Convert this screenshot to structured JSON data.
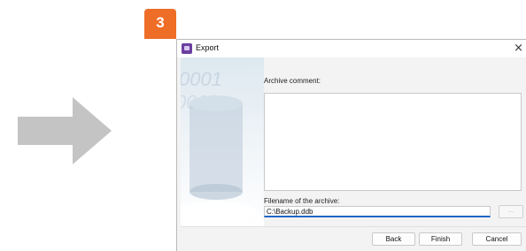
{
  "step_badge": "3",
  "dialog": {
    "title": "Export",
    "close_glyph": "×",
    "side_image_text": [
      "0001",
      "0010"
    ],
    "comment_label": "Archive comment:",
    "comment_value": "",
    "filename_label": "Filename of the archive:",
    "filename_value": "C:\\Backup.ddb",
    "browse_label": "...",
    "buttons": {
      "back": "Back",
      "finish": "Finish",
      "cancel": "Cancel"
    }
  },
  "colors": {
    "badge": "#ee6d27",
    "arrow": "#c4c4c4",
    "input_focus": "#2066c8"
  }
}
